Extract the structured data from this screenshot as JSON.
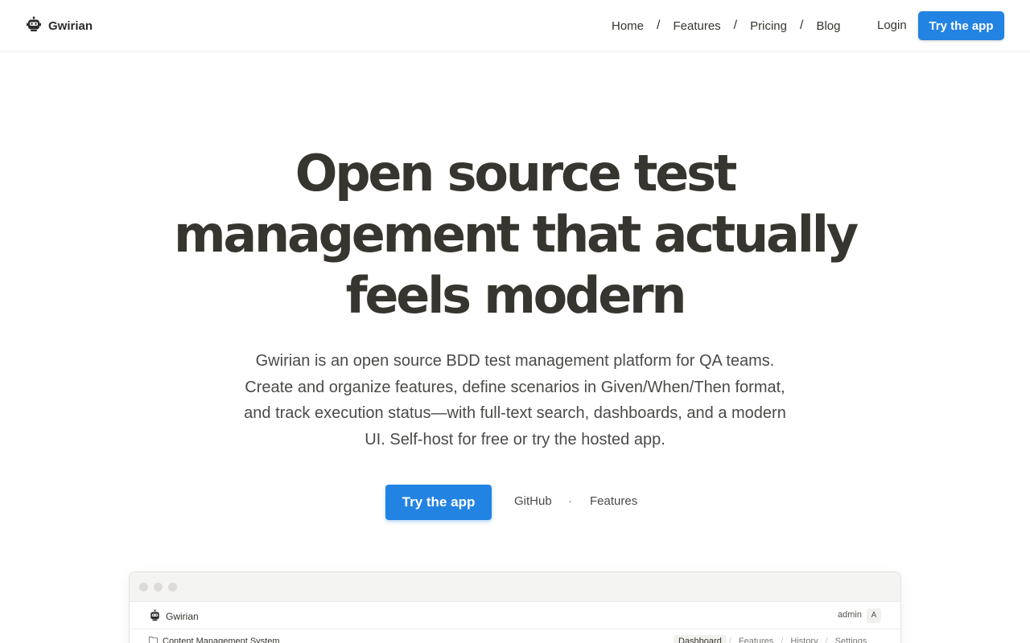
{
  "header": {
    "brand_name": "Gwirian",
    "brand_icon": "robot-logo-icon",
    "nav": [
      {
        "label": "Home"
      },
      {
        "label": "Features"
      },
      {
        "label": "Pricing"
      },
      {
        "label": "Blog"
      }
    ],
    "nav_separator": "/",
    "login_label": "Login",
    "cta_label": "Try the app"
  },
  "hero": {
    "title_lines": [
      "Open source test",
      "management that actually",
      "feels modern"
    ],
    "subtitle": "Gwirian is an open source BDD test management platform for QA teams. Create and organize features, define scenarios in Given/When/Then format, and track execution status—with full-text search, dashboards, and a modern UI. Self-host for free or try the hosted app.",
    "cta_label": "Try the app",
    "github_label": "GitHub",
    "dot": "·",
    "features_label": "Features"
  },
  "preview": {
    "brand_name": "Gwirian",
    "user_name": "admin",
    "avatar_letter": "A",
    "project_name": "Content Management System",
    "tabs": [
      {
        "label": "Dashboard",
        "active": true
      },
      {
        "label": "Features",
        "active": false
      },
      {
        "label": "History",
        "active": false
      },
      {
        "label": "Settings",
        "active": false
      }
    ],
    "tab_separator": "/"
  },
  "colors": {
    "accent": "#2383e2",
    "text": "#37352f",
    "border": "#e9e9e7"
  }
}
